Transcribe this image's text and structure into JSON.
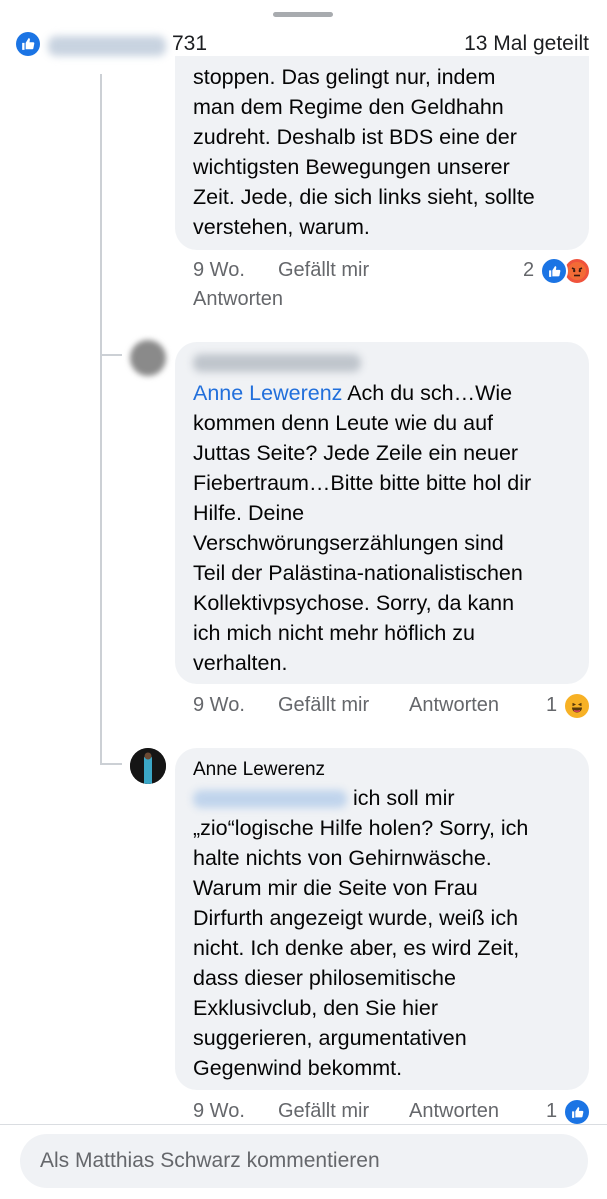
{
  "header": {
    "reaction_count": "731",
    "shares": "13 Mal geteilt",
    "like_color": "#1b74e4"
  },
  "comments": [
    {
      "text": "stoppen. Das gelingt nur, indem\nman dem Regime den Geldhahn\nzudreht. Deshalb ist BDS eine der\nwichtigsten Bewegungen unserer\nZeit. Jede, die sich links sieht, sollte\nverstehen, warum.",
      "time": "9 Wo.",
      "like": "Gefällt mir",
      "reply": "Antworten",
      "reaction_count": "2",
      "reactions": [
        "like-icon",
        "angry-icon"
      ]
    },
    {
      "mention": "Anne Lewerenz",
      "text": " Ach du sch…Wie\nkommen denn Leute wie du auf\nJuttas Seite? Jede Zeile ein neuer\nFiebertraum…Bitte bitte bitte hol dir\nHilfe. Deine\nVerschwörungserzählungen sind\nTeil der Palästina-nationalistischen\nKollektivpsychose. Sorry, da kann\nich mich nicht mehr höflich zu\nverhalten.",
      "time": "9 Wo.",
      "like": "Gefällt mir",
      "reply": "Antworten",
      "reaction_count": "1",
      "reactions": [
        "laugh-icon"
      ]
    },
    {
      "author": "Anne Lewerenz",
      "text_first": " ich soll mir",
      "text": "„zio“logische Hilfe holen? Sorry, ich\nhalte nichts von Gehirnwäsche.\nWarum mir die Seite von Frau\nDirfurth angezeigt wurde, weiß ich\nnicht. Ich denke aber, es wird Zeit,\ndass dieser philosemitische\nExklusivclub, den Sie hier\nsuggerieren, argumentativen\nGegenwind bekommt.",
      "time": "9 Wo.",
      "like": "Gefällt mir",
      "reply": "Antworten",
      "reaction_count": "1",
      "reactions": [
        "like-icon"
      ]
    }
  ],
  "composer": {
    "placeholder": "Als Matthias Schwarz kommentieren"
  }
}
